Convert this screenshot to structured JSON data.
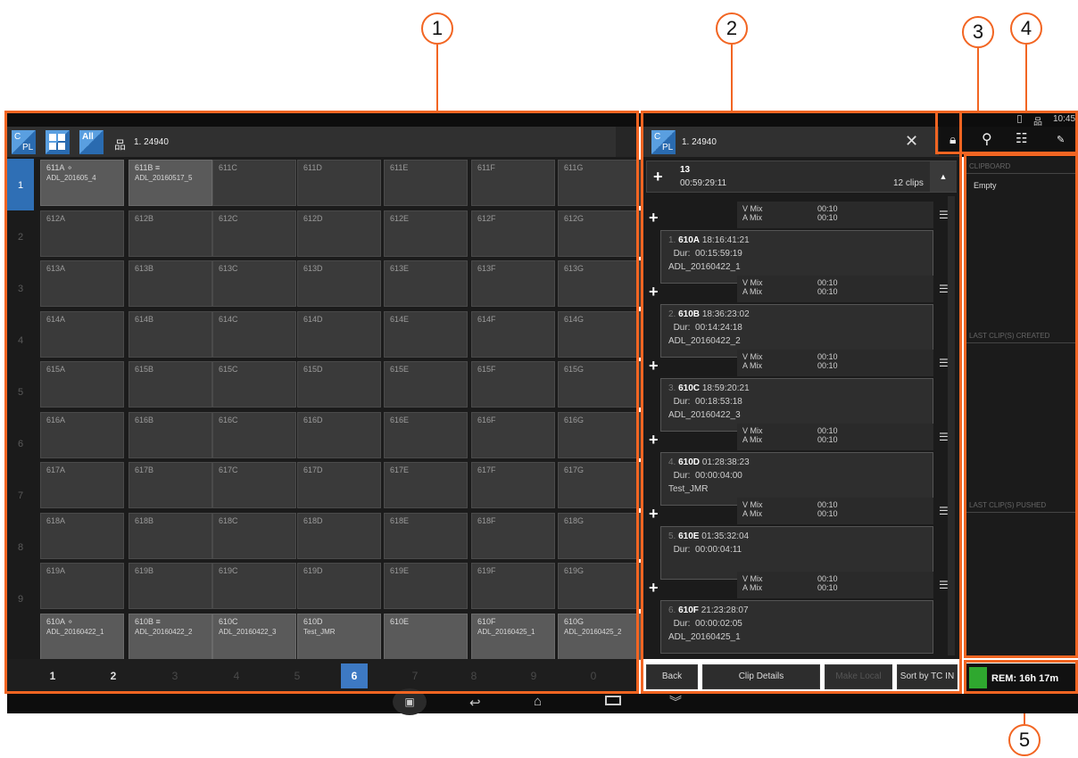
{
  "callouts": [
    "1",
    "2",
    "3",
    "4",
    "5"
  ],
  "status_bar": {
    "time": "10:45"
  },
  "bin": {
    "tab_label": "1. 24940",
    "tool_icons": [
      "cpl-icon",
      "grid-view-icon",
      "all-filter-icon",
      "hierarchy-icon"
    ],
    "all_label": "All",
    "cpl_label": "C",
    "cpl_sub": "PL",
    "row_numbers": [
      "1",
      "2",
      "3",
      "4",
      "5",
      "6",
      "7",
      "8",
      "9"
    ],
    "rows": [
      [
        "611A ⚬",
        "611B ≡",
        "611C",
        "611D",
        "611E",
        "611F",
        "611G"
      ],
      [
        "612A",
        "612B",
        "612C",
        "612D",
        "612E",
        "612F",
        "612G"
      ],
      [
        "613A",
        "613B",
        "613C",
        "613D",
        "613E",
        "613F",
        "613G"
      ],
      [
        "614A",
        "614B",
        "614C",
        "614D",
        "614E",
        "614F",
        "614G"
      ],
      [
        "615A",
        "615B",
        "615C",
        "615D",
        "615E",
        "615F",
        "615G"
      ],
      [
        "616A",
        "616B",
        "616C",
        "616D",
        "616E",
        "616F",
        "616G"
      ],
      [
        "617A",
        "617B",
        "617C",
        "617D",
        "617E",
        "617F",
        "617G"
      ],
      [
        "618A",
        "618B",
        "618C",
        "618D",
        "618E",
        "618F",
        "618G"
      ],
      [
        "619A",
        "619B",
        "619C",
        "619D",
        "619E",
        "619F",
        "619G"
      ],
      [
        "610A ⚬",
        "610B ≡",
        "610C",
        "610D",
        "610E",
        "610F",
        "610G"
      ]
    ],
    "row1_subs": [
      "ADL_201605_4",
      "ADL_20160517_5"
    ],
    "last_row_subs": [
      "ADL_20160422_1",
      "ADL_20160422_2",
      "ADL_20160422_3",
      "Test_JMR",
      "",
      "ADL_20160425_1",
      "ADL_20160425_2"
    ],
    "pages": [
      "1",
      "2",
      "3",
      "4",
      "5",
      "6",
      "7",
      "8",
      "9",
      "0"
    ]
  },
  "playlist": {
    "tab_label": "1. 24940",
    "header_num": "13",
    "header_tc": "00:59:29:11",
    "header_count": "12 clips",
    "trans": {
      "v": "V Mix",
      "a": "A Mix",
      "v_dur": "00:10",
      "a_dur": "00:10"
    },
    "dur_label": "Dur:",
    "clips": [
      {
        "idx": "1.",
        "name": "610A",
        "tc": "18:16:41:21",
        "dur": "00:15:59:19",
        "file": "ADL_20160422_1"
      },
      {
        "idx": "2.",
        "name": "610B",
        "tc": "18:36:23:02",
        "dur": "00:14:24:18",
        "file": "ADL_20160422_2"
      },
      {
        "idx": "3.",
        "name": "610C",
        "tc": "18:59:20:21",
        "dur": "00:18:53:18",
        "file": "ADL_20160422_3"
      },
      {
        "idx": "4.",
        "name": "610D",
        "tc": "01:28:38:23",
        "dur": "00:00:04:00",
        "file": "Test_JMR"
      },
      {
        "idx": "5.",
        "name": "610E",
        "tc": "01:35:32:04",
        "dur": "00:00:04:11",
        "file": ""
      },
      {
        "idx": "6.",
        "name": "610F",
        "tc": "21:23:28:07",
        "dur": "00:00:02:05",
        "file": "ADL_20160425_1"
      }
    ],
    "buttons": {
      "back": "Back",
      "details": "Clip Details",
      "make_local": "Make Local",
      "sort": "Sort by TC IN"
    }
  },
  "sidebar": {
    "clipboard_label": "CLIPBOARD",
    "clipboard_value": "Empty",
    "created_label": "LAST CLIP(S) CREATED",
    "pushed_label": "LAST CLIP(S) PUSHED",
    "rem": "REM: 16h 17m",
    "rem_color": "#2fa82f"
  },
  "colors": {
    "accent": "#f26522",
    "selected": "#3d79c3"
  }
}
